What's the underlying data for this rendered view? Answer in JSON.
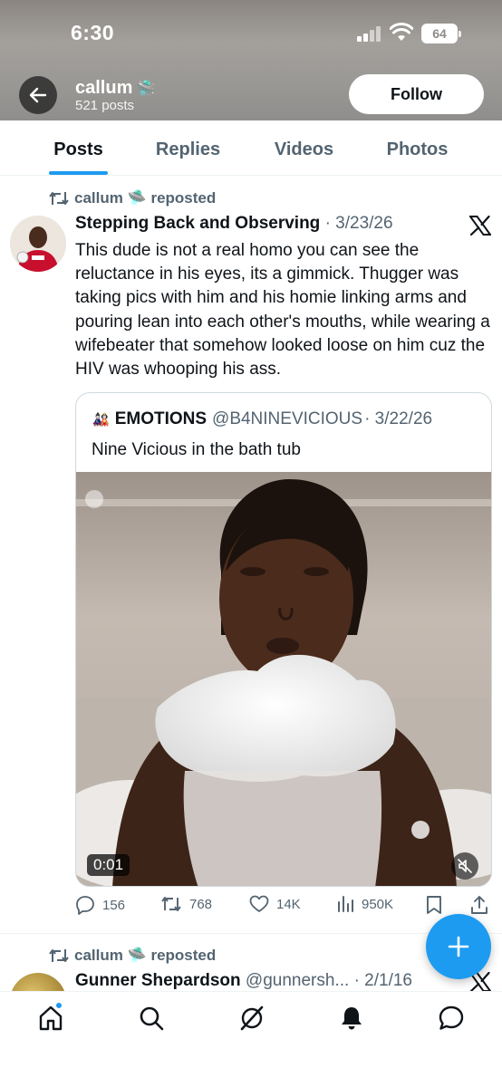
{
  "status_bar": {
    "time": "6:30",
    "battery": "64"
  },
  "profile": {
    "name": "callum",
    "emoji": "🛸",
    "posts_count": "521 posts",
    "follow_label": "Follow"
  },
  "tabs": [
    {
      "label": "Posts",
      "active": true
    },
    {
      "label": "Replies",
      "active": false
    },
    {
      "label": "Videos",
      "active": false
    },
    {
      "label": "Photos",
      "active": false
    }
  ],
  "tweets": [
    {
      "repost_by": "callum 🛸 reposted",
      "author": "Stepping Back and Observing",
      "date": "· 3/23/26",
      "text": "This dude is not a real homo you can see the reluctance in his eyes, its a gimmick. Thugger was taking pics with him and his homie linking arms and pouring lean into each other's mouths, while wearing a wifebeater that somehow looked loose on him cuz the HIV was whooping his ass.",
      "quote": {
        "emoji": "🎎",
        "name": "EMOTIONS",
        "handle": "@B4NINEVICIOUS",
        "date": "· 3/22/26",
        "text": "Nine Vicious in the bath tub",
        "video_duration": "0:01"
      },
      "stats": {
        "replies": "156",
        "reposts": "768",
        "likes": "14K",
        "views": "950K"
      }
    },
    {
      "repost_by": "callum 🛸 reposted",
      "author": "Gunner Shepardson",
      "handle": "@gunnersh...",
      "date": "· 2/1/16"
    }
  ],
  "colors": {
    "accent": "#1d9bf0",
    "text": "#0f1419",
    "secondary": "#536471"
  }
}
